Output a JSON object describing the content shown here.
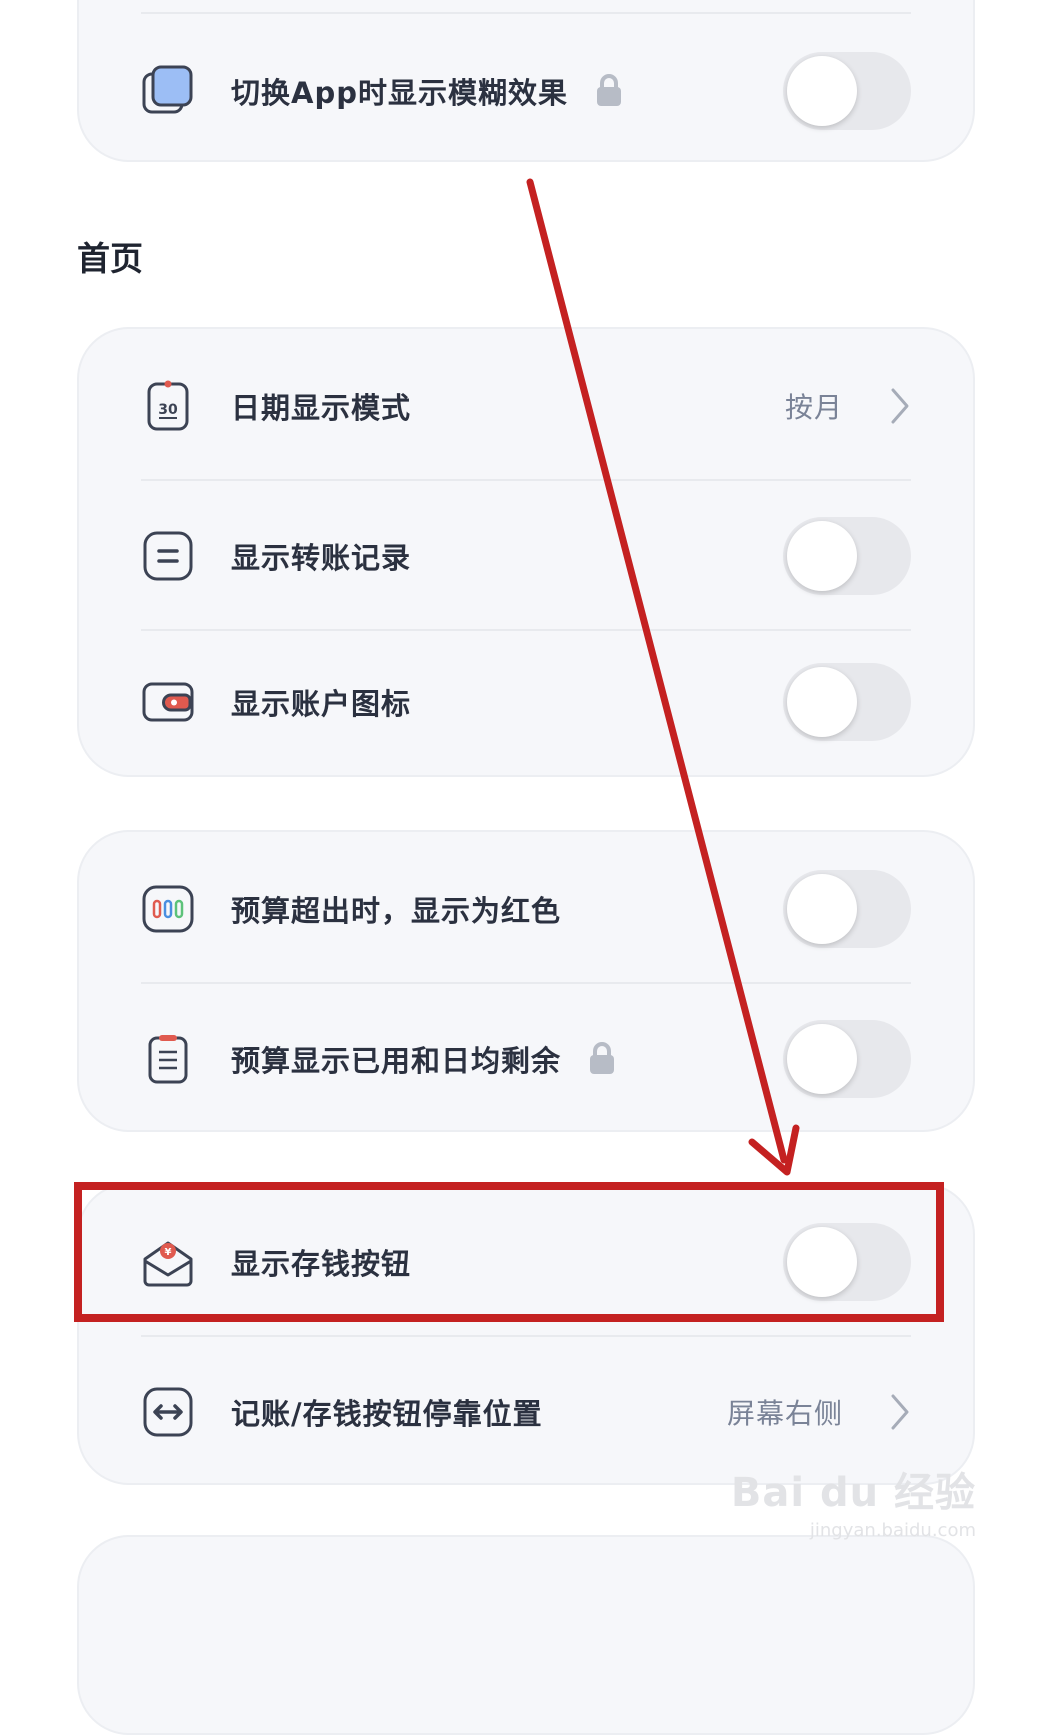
{
  "card_top": {
    "rows": [
      {
        "label": "切换App时显示模糊效果",
        "icon": "stacked-cards-icon",
        "locked": true,
        "toggle_on": false
      }
    ]
  },
  "section_home": {
    "title": "首页"
  },
  "card_home": {
    "rows": [
      {
        "label": "日期显示模式",
        "icon": "calendar-icon",
        "value": "按月"
      },
      {
        "label": "显示转账记录",
        "icon": "transfer-icon",
        "toggle_on": false
      },
      {
        "label": "显示账户图标",
        "icon": "wallet-icon",
        "toggle_on": false
      }
    ]
  },
  "card_budget": {
    "rows": [
      {
        "label": "预算超出时，显示为红色",
        "icon": "budget-bars-icon",
        "toggle_on": false
      },
      {
        "label": "预算显示已用和日均剩余",
        "icon": "clipboard-icon",
        "locked": true,
        "toggle_on": false
      }
    ]
  },
  "card_savings": {
    "rows": [
      {
        "label": "显示存钱按钮",
        "icon": "envelope-coin-icon",
        "toggle_on": false
      },
      {
        "label": "记账/存钱按钮停靠位置",
        "icon": "arrows-horizontal-icon",
        "value": "屏幕右侧"
      }
    ]
  },
  "watermark": {
    "main": "Bai du 经验",
    "sub": "jingyan.baidu.com"
  },
  "colors": {
    "annotation": "#c42121",
    "card_bg": "#f6f7fa",
    "toggle_off": "#e7e8ec",
    "text": "#2b3140",
    "secondary_text": "#7a8397"
  }
}
